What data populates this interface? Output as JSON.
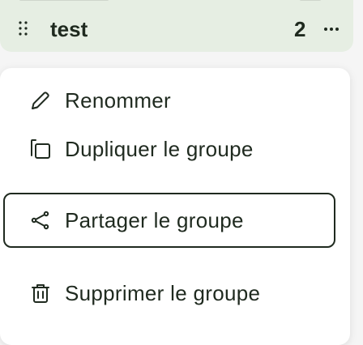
{
  "group": {
    "title": "test",
    "count": "2"
  },
  "icons": {
    "drag": "drag-handle-icon",
    "more": "more-horizontal-icon",
    "rename": "pencil-icon",
    "duplicate": "copy-icon",
    "share": "share-icon",
    "delete": "trash-icon"
  },
  "menu": {
    "items": [
      {
        "label": "Renommer"
      },
      {
        "label": "Dupliquer le groupe"
      },
      {
        "label": "Partager le groupe"
      },
      {
        "label": "Supprimer le groupe"
      }
    ]
  },
  "colors": {
    "card_background": "#e6eee3",
    "text": "#1f2a1f",
    "menu_background": "#ffffff"
  }
}
